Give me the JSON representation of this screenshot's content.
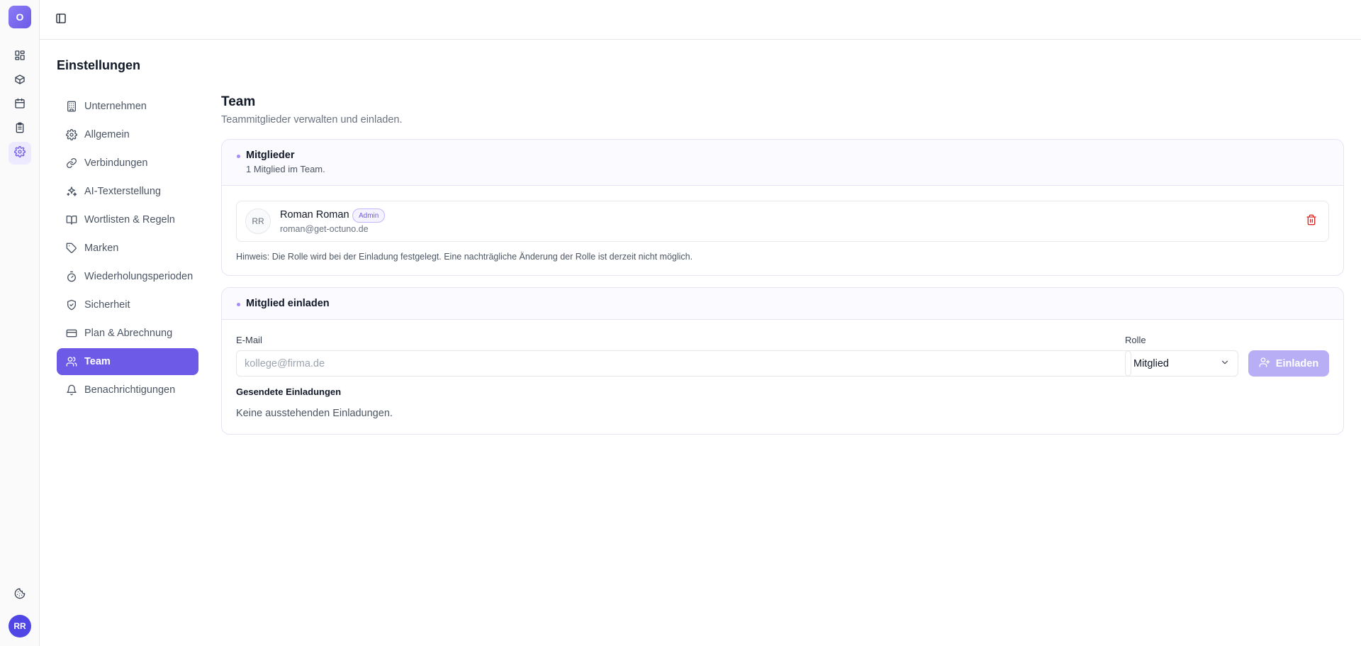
{
  "app": {
    "logo_letter": "O",
    "user_initials": "RR"
  },
  "page": {
    "title": "Einstellungen"
  },
  "settings_nav": [
    {
      "label": "Unternehmen",
      "icon": "building-icon"
    },
    {
      "label": "Allgemein",
      "icon": "gear-icon"
    },
    {
      "label": "Verbindungen",
      "icon": "link-icon"
    },
    {
      "label": "AI-Texterstellung",
      "icon": "sparkles-icon"
    },
    {
      "label": "Wortlisten & Regeln",
      "icon": "book-open-icon"
    },
    {
      "label": "Marken",
      "icon": "tag-icon"
    },
    {
      "label": "Wiederholungsperioden",
      "icon": "timer-icon"
    },
    {
      "label": "Sicherheit",
      "icon": "shield-check-icon"
    },
    {
      "label": "Plan & Abrechnung",
      "icon": "credit-card-icon"
    },
    {
      "label": "Team",
      "icon": "users-icon",
      "active": true
    },
    {
      "label": "Benachrichtigungen",
      "icon": "bell-icon"
    }
  ],
  "team": {
    "title": "Team",
    "subtitle": "Teammitglieder verwalten und einladen."
  },
  "members": {
    "title": "Mitglieder",
    "count_text": "1 Mitglied im Team.",
    "list": [
      {
        "initials": "RR",
        "name": "Roman Roman",
        "role_badge": "Admin",
        "email": "roman@get-octuno.de"
      }
    ],
    "hint": "Hinweis: Die Rolle wird bei der Einladung festgelegt. Eine nachträgliche Änderung der Rolle ist derzeit nicht möglich."
  },
  "invite": {
    "title": "Mitglied einladen",
    "email_label": "E-Mail",
    "email_placeholder": "kollege@firma.de",
    "email_value": "",
    "role_label": "Rolle",
    "role_value": "Mitglied",
    "invite_button": "Einladen",
    "sent_title": "Gesendete Einladungen",
    "sent_empty": "Keine ausstehenden Einladungen."
  },
  "colors": {
    "accent": "#6d5ae6",
    "accent_disabled": "#b8aef5",
    "danger": "#dc2626"
  }
}
